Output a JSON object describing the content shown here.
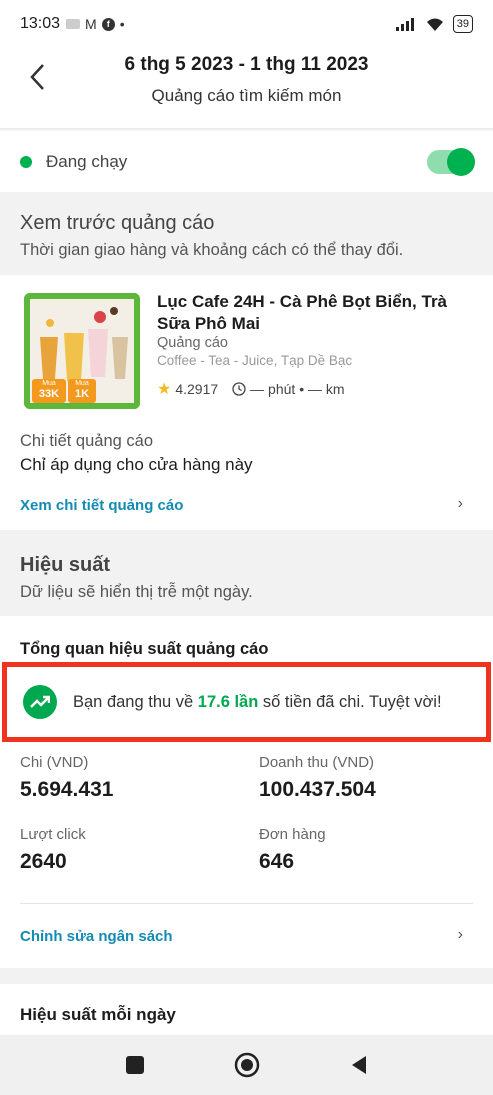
{
  "status_bar": {
    "time": "13:03",
    "battery": "39"
  },
  "header": {
    "title": "6 thg 5 2023 - 1 thg 11 2023",
    "subtitle": "Quảng cáo tìm kiếm món"
  },
  "status": {
    "label": "Đang chạy",
    "toggle_on": true
  },
  "preview": {
    "title": "Xem trước quảng cáo",
    "subtitle": "Thời gian giao hàng và khoảng cách có thể thay đổi.",
    "store_name": "Lục Cafe 24H - Cà Phê Bọt Biển, Trà Sữa Phô Mai",
    "ad_type": "Quảng cáo",
    "categories": "Coffee - Tea - Juice, Tạp Dề Bạc",
    "rating": "4.2917",
    "eta": "— phút • — km",
    "promo_1_label": "Mua",
    "promo_1": "33K",
    "promo_2_label": "Mua",
    "promo_2": "1K"
  },
  "ad_detail": {
    "label": "Chi tiết quảng cáo",
    "text": "Chỉ áp dụng cho cửa hàng này",
    "link": "Xem chi tiết quảng cáo"
  },
  "performance": {
    "title": "Hiệu suất",
    "subtitle": "Dữ liệu sẽ hiển thị trễ một ngày.",
    "overview_title": "Tổng quan hiệu suất quảng cáo",
    "highlight_prefix": "Bạn đang thu về ",
    "highlight_value": "17.6 lần",
    "highlight_suffix": " số tiền đã chi. Tuyệt vời!"
  },
  "stats": {
    "spend_label": "Chi (VND)",
    "spend_value": "5.694.431",
    "revenue_label": "Doanh thu (VND)",
    "revenue_value": "100.437.504",
    "clicks_label": "Lượt click",
    "clicks_value": "2640",
    "orders_label": "Đơn hàng",
    "orders_value": "646"
  },
  "budget": {
    "link": "Chỉnh sửa ngân sách"
  },
  "daily": {
    "title": "Hiệu suất mỗi ngày"
  },
  "colors": {
    "accent_green": "#00b14f",
    "link_blue": "#138bb3",
    "highlight_border": "#f0321e"
  }
}
